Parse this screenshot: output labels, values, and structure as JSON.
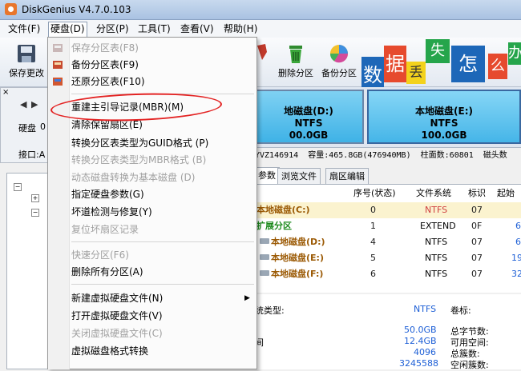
{
  "window": {
    "title": "DiskGenius V4.7.0.103"
  },
  "menubar": [
    {
      "label": "文件(F)"
    },
    {
      "label": "硬盘(D)"
    },
    {
      "label": "分区(P)"
    },
    {
      "label": "工具(T)"
    },
    {
      "label": "查看(V)"
    },
    {
      "label": "帮助(H)"
    }
  ],
  "toolbar": {
    "save_label": "保存更改",
    "delete_partition_label": "删除分区",
    "backup_partition_label": "备份分区",
    "deco_chars": [
      "数",
      "据",
      "丢",
      "失",
      "怎",
      "么",
      "办"
    ]
  },
  "left_panel": {
    "disk_label": "硬盘",
    "disk_value": "0",
    "interface_label": "接口:A",
    "nav_prev": "◀",
    "nav_next": "▶"
  },
  "disk_map": {
    "partition_d": {
      "name": "地磁盘(D:)",
      "fs": "NTFS",
      "size": "00.0GB"
    },
    "partition_e": {
      "name": "本地磁盘(E:)",
      "fs": "NTFS",
      "size": "100.0GB"
    }
  },
  "disk_info": {
    "serial": "YVZ146914",
    "capacity_label": "容量:",
    "capacity_value": "465.8GB(476940MB)",
    "cylinders_label": "柱面数:",
    "cylinders_value": "60801",
    "heads_label": "磁头数"
  },
  "tabs": [
    {
      "label": "参数"
    },
    {
      "label": "浏览文件"
    },
    {
      "label": "扇区编辑"
    }
  ],
  "table": {
    "headers": [
      "序号(状态)",
      "文件系统",
      "标识",
      "起始柱"
    ],
    "rows": [
      {
        "name": "本地磁盘(C:)",
        "index": "0",
        "fs": "NTFS",
        "id": "07",
        "start": ""
      },
      {
        "name": "扩展分区",
        "index": "1",
        "fs": "EXTEND",
        "id": "0F",
        "start": "6"
      },
      {
        "name": "本地磁盘(D:)",
        "index": "4",
        "fs": "NTFS",
        "id": "07",
        "start": "6"
      },
      {
        "name": "本地磁盘(E:)",
        "index": "5",
        "fs": "NTFS",
        "id": "07",
        "start": "19"
      },
      {
        "name": "本地磁盘(F:)",
        "index": "6",
        "fs": "NTFS",
        "id": "07",
        "start": "32"
      }
    ]
  },
  "details": {
    "fs_type_label": "统类型:",
    "fs_type_value": "NTFS",
    "volume_label": "卷标:",
    "rows": [
      {
        "left_label": "",
        "value": "50.0GB",
        "right_label": "总字节数:"
      },
      {
        "left_label": "间",
        "value": "12.4GB",
        "right_label": "可用空间:"
      },
      {
        "left_label": "",
        "value": "4096",
        "right_label": "总簇数:"
      },
      {
        "left_label": "",
        "value": "3245588",
        "right_label": "空闲簇数:"
      }
    ]
  },
  "disk_menu": {
    "items": [
      {
        "label": "保存分区表(F8)",
        "disabled": true
      },
      {
        "label": "备份分区表(F9)",
        "disabled": false
      },
      {
        "label": "还原分区表(F10)",
        "disabled": false
      },
      {
        "label": "重建主引导记录(MBR)(M)",
        "disabled": false
      },
      {
        "label": "清除保留扇区(E)",
        "disabled": false
      },
      {
        "label": "转换分区表类型为GUID格式 (P)",
        "disabled": false
      },
      {
        "label": "转换分区表类型为MBR格式 (B)",
        "disabled": true
      },
      {
        "label": "动态磁盘转换为基本磁盘 (D)",
        "disabled": true
      },
      {
        "label": "指定硬盘参数(G)",
        "disabled": false
      },
      {
        "label": "坏道检测与修复(Y)",
        "disabled": false
      },
      {
        "label": "复位坏扇区记录",
        "disabled": true
      },
      {
        "label": "快速分区(F6)",
        "disabled": true
      },
      {
        "label": "删除所有分区(A)",
        "disabled": false
      },
      {
        "label": "新建虚拟硬盘文件(N)",
        "disabled": false
      },
      {
        "label": "打开虚拟硬盘文件(V)",
        "disabled": false
      },
      {
        "label": "关闭虚拟硬盘文件(C)",
        "disabled": true
      },
      {
        "label": "虚拟磁盘格式转换",
        "disabled": false
      }
    ],
    "submenu_arrow": "▶"
  },
  "colors": {
    "annotation_circle": "#e32222",
    "partition_fill": "#45b5e8",
    "partition_name": "#9b5a05",
    "extended_partition": "#1c8a1c",
    "detail_value": "#1d5fd6"
  }
}
